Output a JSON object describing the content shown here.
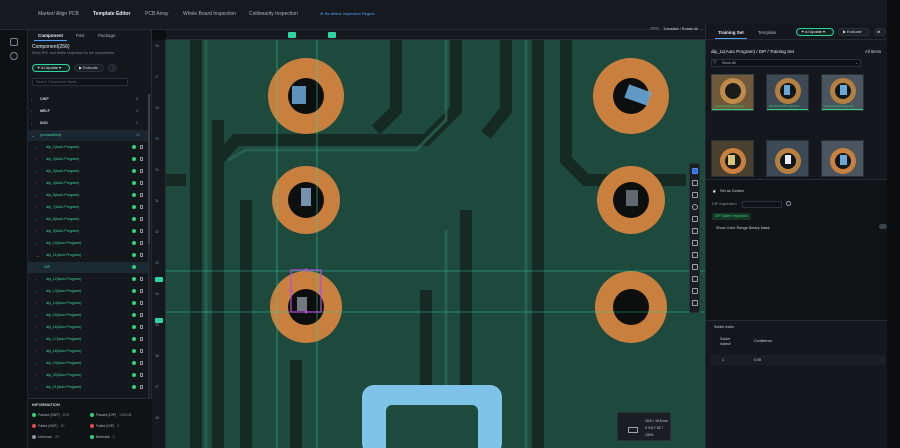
{
  "topbar": {
    "menus": [
      "Marker/ Align PCB",
      "Template Editor",
      "PCB Array",
      "Whole Board Inspection",
      "Coilinearity Inspection"
    ],
    "active_index": 1,
    "hint": "Re-define inspection Region",
    "translate_label": "Translate / Rotate All"
  },
  "left": {
    "tabs": [
      "Component",
      "Part",
      "Package"
    ],
    "title": "Component(256)",
    "subtitle": "Show ROI, and define inspection for the components.",
    "ai_update": "AI Update",
    "evaluate": "Evaluate",
    "search_placeholder": "Search Component Name...",
    "groups": [
      {
        "label": "CHIP",
        "count": "5"
      },
      {
        "label": "MELF",
        "count": "4"
      },
      {
        "label": "SOD",
        "count": "2"
      },
      {
        "label": "(unclassified)",
        "count": "21"
      }
    ],
    "items": [
      "dip_1(Auto Program)",
      "dip_2(Auto Program)",
      "dip_3(Auto Program)",
      "dip_4(Auto Program)",
      "dip_5(Auto Program)",
      "dip_7(Auto Program)",
      "dip_8(Auto Program)",
      "dip_9(Auto Program)",
      "dip_10(Auto Program)",
      "dip_11(Auto Program)",
      "DIP",
      "dip_12(Auto Program)",
      "dip_13(Auto Program)",
      "dip_14(Auto Program)",
      "dip_15(Auto Program)",
      "dip_16(Auto Program)",
      "dip_17(Auto Program)",
      "dip_18(Auto Program)",
      "dip_19(Auto Program)",
      "dip_20(Auto Program)",
      "dip_21(Auto Program)"
    ]
  },
  "info": {
    "heading": "INFORMATION",
    "stats": [
      {
        "label": "Passed (SMT)",
        "value": "5/30",
        "color": "#2fd37a"
      },
      {
        "label": "Passed (DIP)",
        "value": "108/108",
        "color": "#2fd37a"
      },
      {
        "label": "Failed (SMT)",
        "value": "20",
        "color": "#e5484d"
      },
      {
        "label": "Failed (DIP)",
        "value": "0",
        "color": "#e5484d"
      },
      {
        "label": "Unknown",
        "value": "20",
        "color": "#8a949e"
      },
      {
        "label": "Badmark",
        "value": "0",
        "color": "#2fd37a"
      }
    ]
  },
  "canvas": {
    "ruler_left_ticks": [
      "26",
      "27",
      "28",
      "29",
      "30",
      "31",
      "32",
      "33",
      "34",
      "35",
      "36",
      "37",
      "38"
    ],
    "size_readout": [
      "18.8 × 18.8 mm",
      "X 9.8 Y 33.7",
      "100%"
    ]
  },
  "right": {
    "tabs": [
      "Training Set",
      "Template"
    ],
    "ai_update": "AI Update",
    "evaluate": "Evaluate",
    "breadcrumb": "dip_11(Auto Program) / DIP / Training Set",
    "all_items": "All Items",
    "filter": "Show All",
    "thumbs": [
      {
        "caption": "Cut Rotate DIP Inspection"
      },
      {
        "caption": "Edit Rotate DIP Inspection"
      },
      {
        "caption": "Cut Rotate DIP Inspection"
      },
      {
        "caption": ""
      },
      {
        "caption": ""
      },
      {
        "caption": ""
      }
    ],
    "set_golden": "Set as Golden",
    "dip_position_label": "DIP Inspection",
    "chip_label": "DIP Solder Inspection",
    "color_range_label": "Show Color Range Binary Mask",
    "table": {
      "title": "Solder Index",
      "col1": "Solder index#",
      "col2": "Confidence",
      "row_index": "1",
      "row_conf": "0.05"
    }
  },
  "colors": {
    "accent": "#2fd3a4",
    "pass": "#2fd37a",
    "fail": "#e5484d",
    "board_green": "#1d4a3d",
    "copper": "#c9803f"
  }
}
